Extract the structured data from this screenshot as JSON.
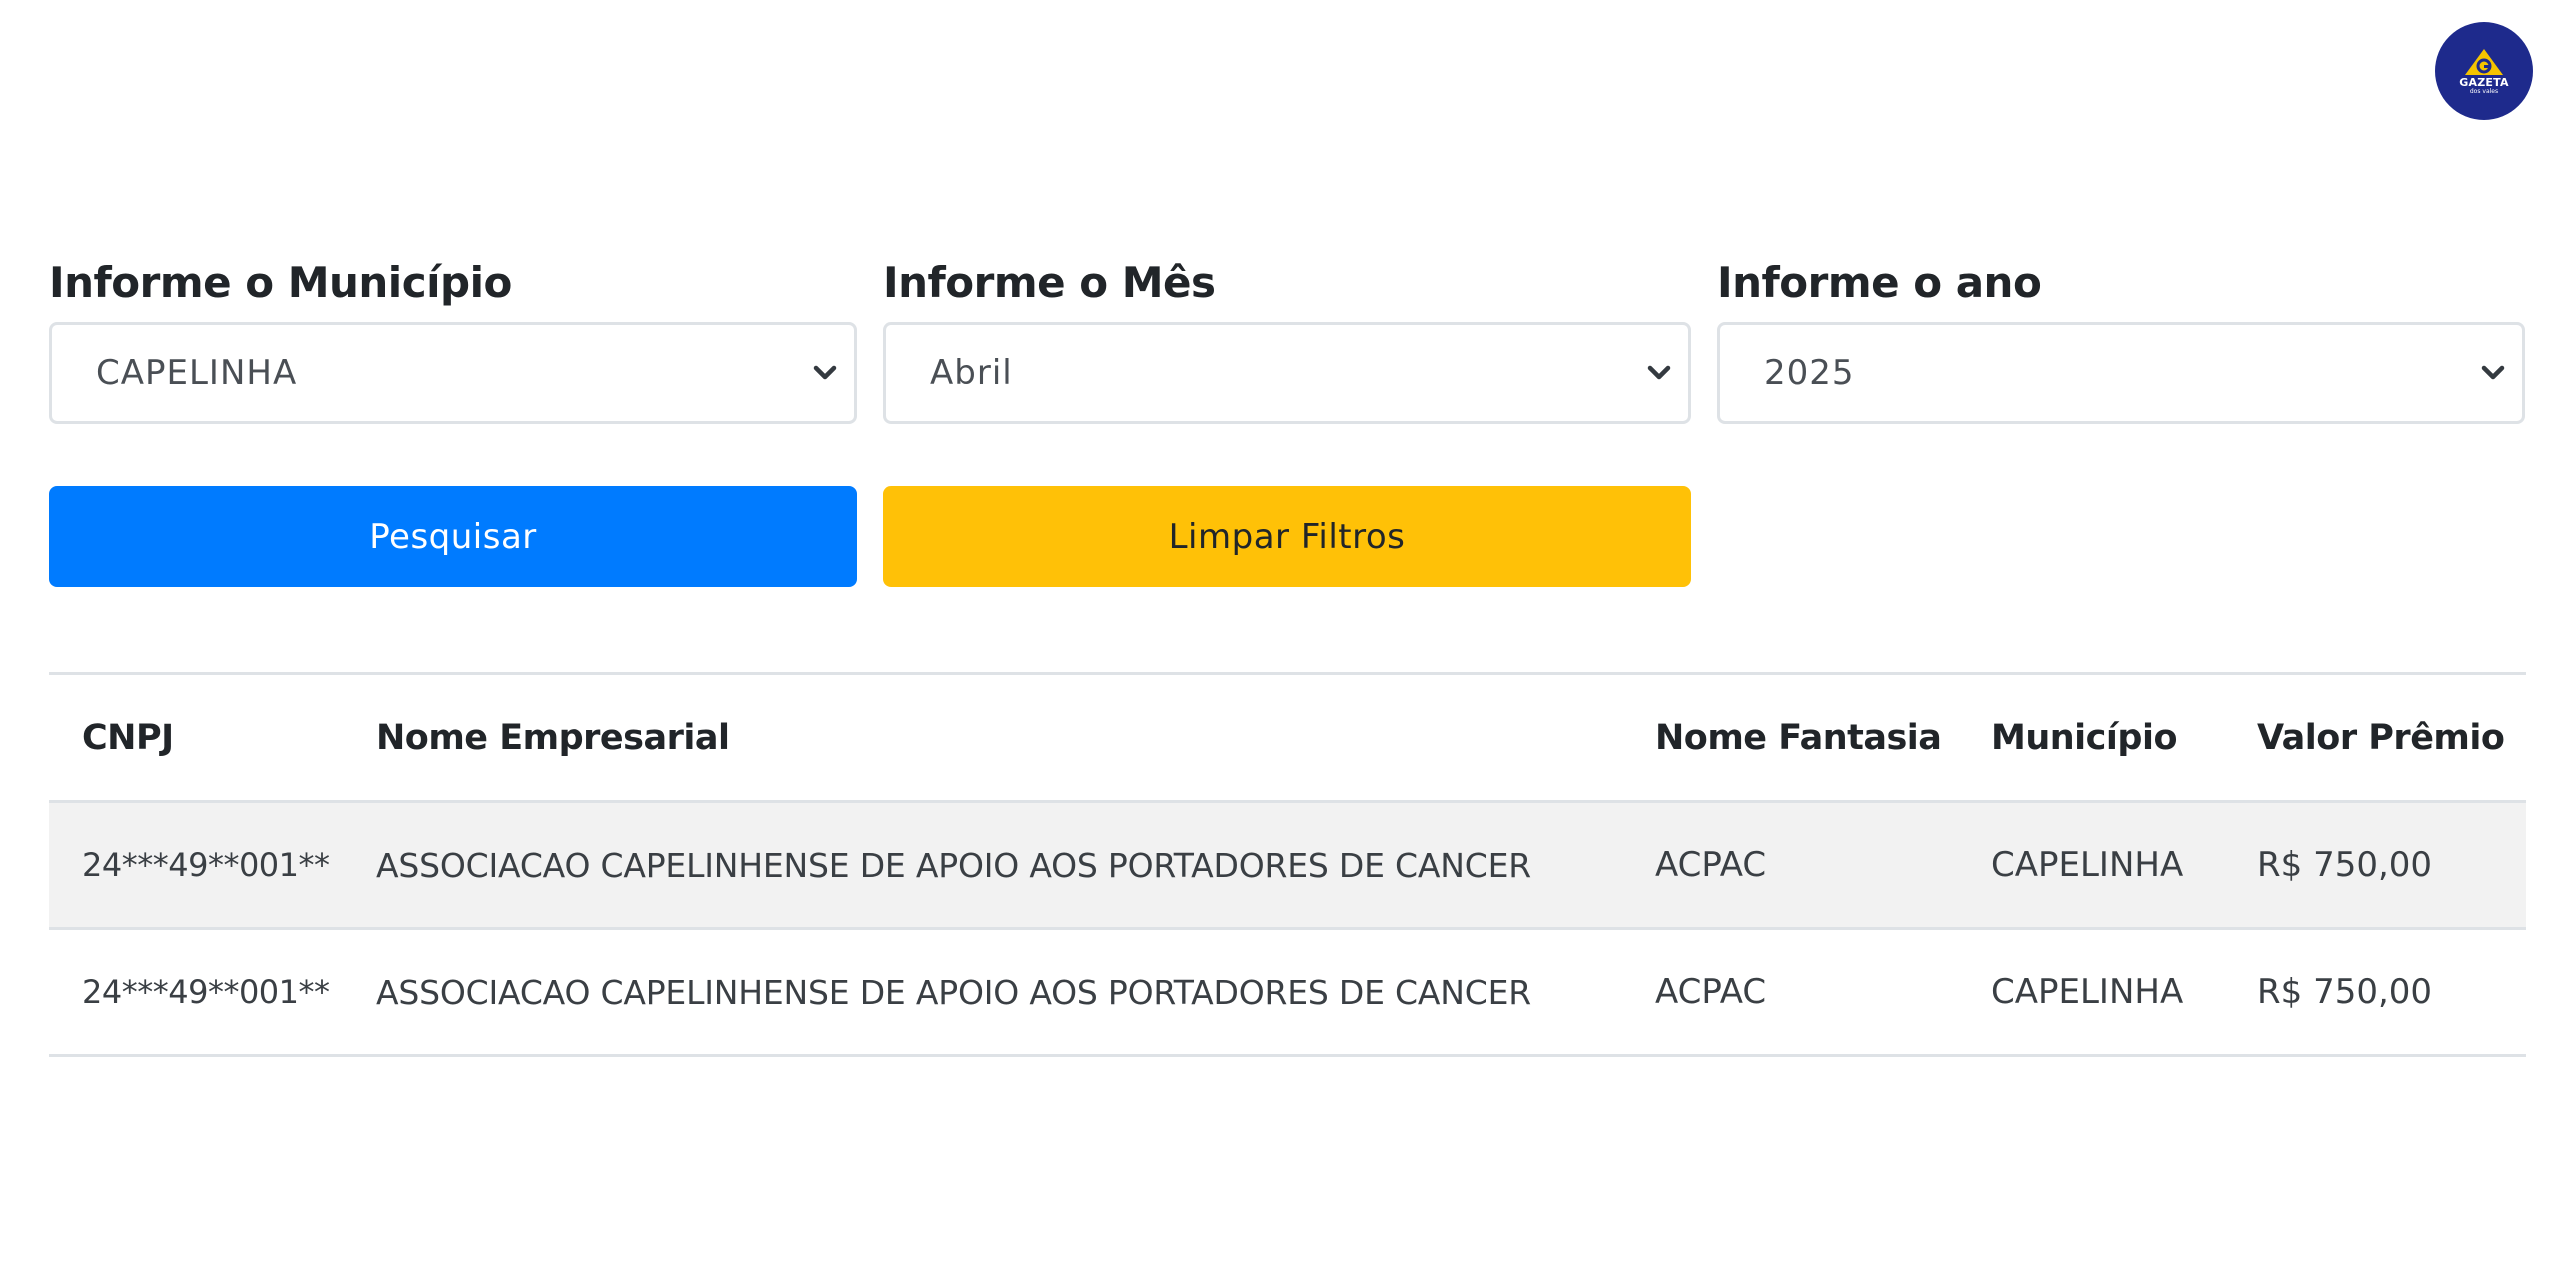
{
  "logo": {
    "name": "GAZETA",
    "sub": "dos vales"
  },
  "filters": [
    {
      "label": "Informe o Município",
      "value": "CAPELINHA"
    },
    {
      "label": "Informe o Mês",
      "value": "Abril"
    },
    {
      "label": "Informe o ano",
      "value": "2025"
    }
  ],
  "buttons": {
    "search": "Pesquisar",
    "clear": "Limpar Filtros"
  },
  "colors": {
    "primary": "#007bff",
    "warning": "#ffc107",
    "logo_bg": "#1e2a8c",
    "logo_accent": "#f5c400"
  },
  "table": {
    "headers": {
      "cnpj": "CNPJ",
      "nome_empresarial": "Nome Empresarial",
      "nome_fantasia": "Nome Fantasia",
      "municipio": "Município",
      "valor_premio": "Valor Prêmio"
    },
    "rows": [
      {
        "cnpj": "24***49**001**",
        "nome_empresarial": "ASSOCIACAO CAPELINHENSE DE APOIO AOS PORTADORES DE CANCER",
        "nome_fantasia": "ACPAC",
        "municipio": "CAPELINHA",
        "valor_premio": "R$ 750,00"
      },
      {
        "cnpj": "24***49**001**",
        "nome_empresarial": "ASSOCIACAO CAPELINHENSE DE APOIO AOS PORTADORES DE CANCER",
        "nome_fantasia": "ACPAC",
        "municipio": "CAPELINHA",
        "valor_premio": "R$ 750,00"
      }
    ]
  }
}
